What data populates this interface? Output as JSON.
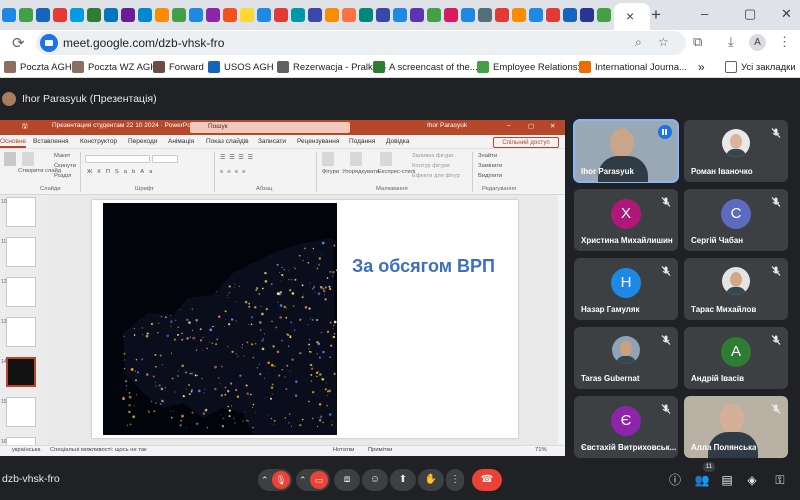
{
  "browser": {
    "tab_close": "×",
    "new_tab": "+",
    "favicon_colors": [
      "#1e88e5",
      "#43a047",
      "#1565c0",
      "#e53935",
      "#039be5",
      "#2e7d32",
      "#0277bd",
      "#6a1b9a",
      "#0288d1",
      "#fb8c00",
      "#43a047",
      "#1e88e5",
      "#8e24aa",
      "#f4511e",
      "#fdd835",
      "#1e88e5",
      "#e53935",
      "#0097a7",
      "#3949ab",
      "#fb8c00",
      "#ff7043",
      "#00897b",
      "#3949ab",
      "#1e88e5",
      "#5e35b1",
      "#43a047",
      "#d81b60",
      "#1e88e5",
      "#546e7a",
      "#e53935",
      "#fb8c00",
      "#1e88e5",
      "#e53935",
      "#1565c0",
      "#283593",
      "#43a047",
      "#fbc02d",
      "#f4511e",
      "#1e88e5",
      "#43a047",
      "#8e24aa",
      "#e53935",
      "#fb8c00",
      "#3949ab",
      "#0288d1",
      "#e53935",
      "#fb8c00",
      "#fb8c00",
      "#f57c00",
      "#fb8c00",
      "#fbc02d",
      "#fb8c00",
      "#fbc02d",
      "#ef6c00",
      "#fbc02d",
      "#f9a825"
    ],
    "url": "meet.google.com/dzb-vhsk-fro",
    "profile_initial": "A",
    "window_controls": {
      "minimize": "–",
      "maximize": "▢",
      "close": "✕"
    }
  },
  "bookmarks": [
    {
      "label": "Poczta AGH",
      "color": "#8d6e63"
    },
    {
      "label": "Poczta WZ AGH",
      "color": "#8d6e63"
    },
    {
      "label": "Forward",
      "color": "#6d4c41"
    },
    {
      "label": "USOS AGH",
      "color": "#1565c0"
    },
    {
      "label": "Rezerwacja - Pralka 6",
      "color": "#616161"
    },
    {
      "label": "A screencast of the...",
      "color": "#2e7d32"
    },
    {
      "label": "Employee Relations:...",
      "color": "#43a047"
    },
    {
      "label": "International Journa...",
      "color": "#ef6c00"
    }
  ],
  "bookmarks_more": "»",
  "bookmarks_all": "Усі закладки",
  "meet": {
    "presenter_title": "Ihor Parasyuk (Презентація)",
    "meeting_code": "dzb-vhsk-fro",
    "participant_count": "11"
  },
  "powerpoint": {
    "title": "Презентация студентам 22 10 2024 · PowerPoint",
    "search_placeholder": "Пошук",
    "user": "Ihor Parasyuk",
    "menu": [
      "Основне",
      "Вставлення",
      "Конструктор",
      "Переходи",
      "Анімація",
      "Показ слайдів",
      "Записати",
      "Рецензування",
      "Подання",
      "Довідка"
    ],
    "share": "Спільний доступ",
    "ribbon": {
      "new_slide": "Створити слайд",
      "layout": "Макет",
      "reset": "Скинути",
      "section": "Розділ",
      "shapes": "Фігури",
      "arrange": "Упорядкувати",
      "quick_styles": "Експрес-стилі",
      "fill": "Заливка фігури",
      "outline": "Контур фігури",
      "effects": "Ефекти для фігур",
      "find": "Знайти",
      "replace": "Замінити",
      "select": "Виділити",
      "groups": {
        "slides": "Слайди",
        "font": "Шрифт",
        "paragraph": "Абзац",
        "drawing": "Малювання",
        "editing": "Редагування"
      }
    },
    "thumbnail_numbers": [
      "10",
      "11",
      "12",
      "13",
      "14",
      "15",
      "16"
    ],
    "slide_heading": "За обсягом ВРП",
    "status": {
      "language": "українська",
      "accessibility": "Спеціальні можливості: щось не так",
      "notes": "Нотатки",
      "comments": "Примітки",
      "zoom": "71%"
    }
  },
  "participants": [
    {
      "name": "Ihor Parasyuk",
      "type": "video",
      "speaking": true,
      "skin": "#c9a58a",
      "bg": "#9aa7b4"
    },
    {
      "name": "Роман Іваночко",
      "type": "photo",
      "muted": true,
      "skin": "#d8b49a",
      "bg": "#e8e8e8"
    },
    {
      "name": "Христина Михайлишин",
      "type": "initial",
      "initial": "Х",
      "color": "#b0177a",
      "muted": true
    },
    {
      "name": "Сергій Чабан",
      "type": "initial",
      "initial": "С",
      "color": "#5c6bc0",
      "muted": true
    },
    {
      "name": "Назар Гамуляк",
      "type": "initial",
      "initial": "Н",
      "color": "#1e88e5",
      "muted": true
    },
    {
      "name": "Тарас Михайлов",
      "type": "photo",
      "muted": true,
      "skin": "#d2a888",
      "bg": "#e4e4e4"
    },
    {
      "name": "Taras Gubernat",
      "type": "photo",
      "muted": true,
      "skin": "#caa080",
      "bg": "#8fa3b5"
    },
    {
      "name": "Андрій Івасів",
      "type": "initial",
      "initial": "А",
      "color": "#2e7d32",
      "muted": true
    },
    {
      "name": "Євстахій Витриховськ...",
      "type": "initial",
      "initial": "Є",
      "color": "#8e24aa",
      "muted": true
    },
    {
      "name": "Алла Полянська",
      "type": "video",
      "muted": true,
      "skin": "#d4b098",
      "bg": "#b9b1a4"
    }
  ]
}
